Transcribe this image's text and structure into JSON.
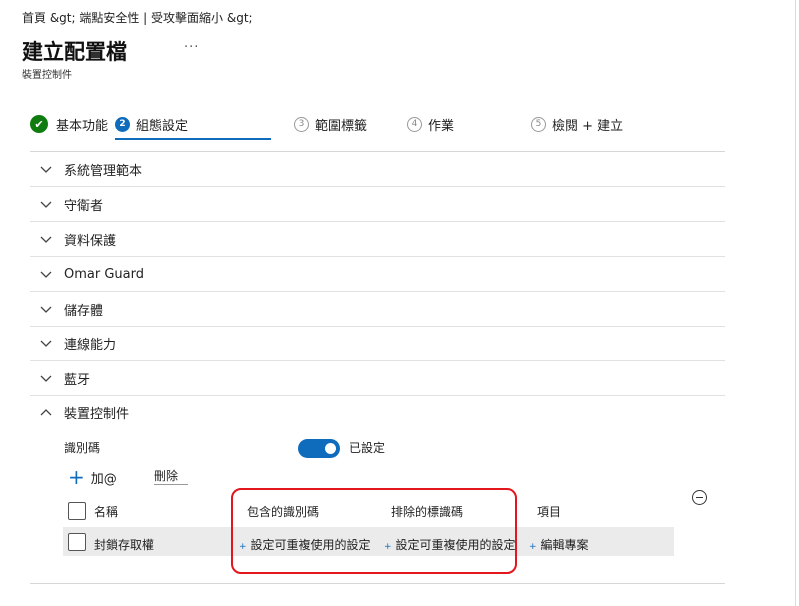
{
  "breadcrumb": "首頁 &gt;  端點安全性 | 受攻擊面縮小 &gt;",
  "page_title": "建立配置檔",
  "more_label": "···",
  "subtitle": "裝置控制件",
  "steps": [
    {
      "label": "基本功能",
      "state": "done",
      "marker": "✔"
    },
    {
      "label": "組態設定",
      "state": "active",
      "marker": "2"
    },
    {
      "label": "範圍標籤",
      "state": "future",
      "marker": "3"
    },
    {
      "label": "作業",
      "state": "future",
      "marker": "4"
    },
    {
      "label": "檢閱 + 建立",
      "state": "future",
      "marker": "5"
    }
  ],
  "sections": [
    {
      "label": "系統管理範本",
      "expanded": false
    },
    {
      "label": "守衛者",
      "expanded": false
    },
    {
      "label": "資料保護",
      "expanded": false
    },
    {
      "label": "Omar Guard",
      "expanded": false
    },
    {
      "label": "儲存體",
      "expanded": false
    },
    {
      "label": "連線能力",
      "expanded": false
    },
    {
      "label": "藍牙",
      "expanded": false
    },
    {
      "label": "裝置控制件",
      "expanded": true
    }
  ],
  "device_control": {
    "identifier_label": "識別碼",
    "toggle_state_label": "已設定",
    "toggle_on": true,
    "add_label": "加@",
    "delete_label": "刪除",
    "table": {
      "headers": [
        "名稱",
        "包含的識別碼",
        "排除的標識碼",
        "項目"
      ],
      "rows": [
        {
          "name": "封鎖存取權",
          "included": "設定可重複使用的設定",
          "excluded": "設定可重複使用的設定",
          "entries": "編輯專案"
        }
      ]
    }
  },
  "colors": {
    "accent": "#0f6cbd",
    "success": "#107c10",
    "highlight": "#e3161c",
    "row_bg": "#ebebeb"
  }
}
